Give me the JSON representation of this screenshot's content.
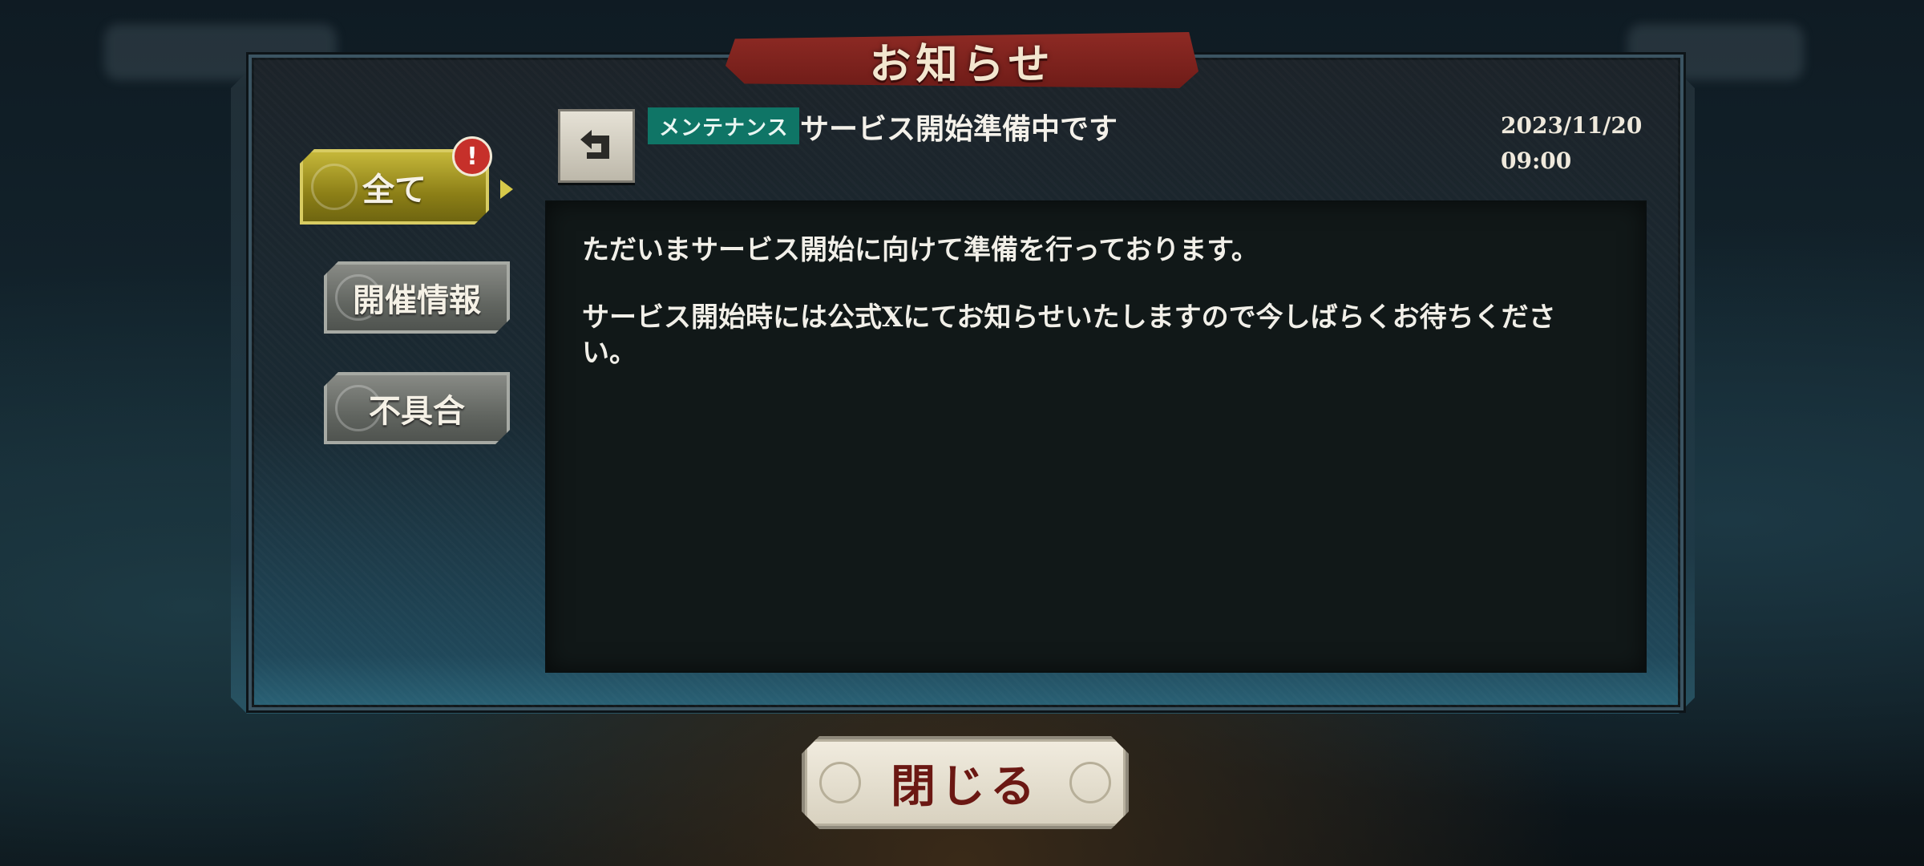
{
  "dialog": {
    "title": "お知らせ",
    "close_label": "閉じる"
  },
  "tabs": [
    {
      "label": "全て",
      "active": true,
      "alert": "!"
    },
    {
      "label": "開催情報",
      "active": false
    },
    {
      "label": "不具合",
      "active": false
    }
  ],
  "notice": {
    "category": "メンテナンス",
    "title": "サービス開始準備中です",
    "date": "2023/11/20",
    "time": "09:00",
    "body": [
      "ただいまサービス開始に向けて準備を行っております。",
      "サービス開始時には公式Xにてお知らせいたしますので今しばらくお待ちください。"
    ]
  },
  "colors": {
    "active_tab": "#a89a2a",
    "category_tag": "#0f7566",
    "title_banner": "#7e241f",
    "alert_badge": "#c6302a"
  },
  "icons": {
    "back": "back-arrow-icon",
    "alert": "exclamation-icon"
  }
}
